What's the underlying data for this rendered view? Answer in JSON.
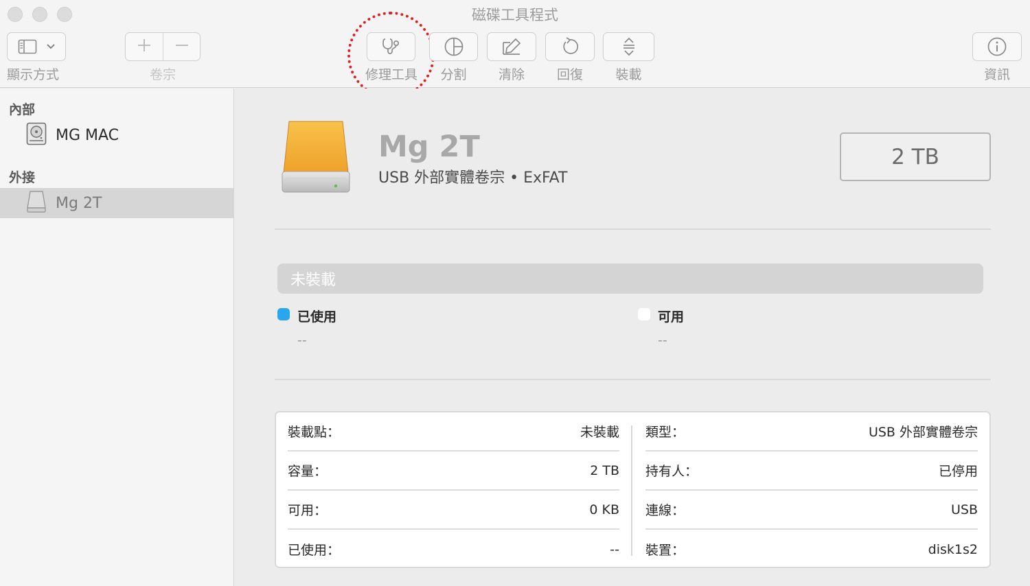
{
  "window": {
    "title": "磁碟工具程式"
  },
  "toolbar": {
    "view_label": "顯示方式",
    "volume_label": "卷宗",
    "repair_label": "修理工具",
    "partition_label": "分割",
    "erase_label": "清除",
    "restore_label": "回復",
    "mount_label": "裝載",
    "info_label": "資訊",
    "highlight_color": "#e02020"
  },
  "sidebar": {
    "internal_header": "內部",
    "internal_items": [
      {
        "label": "MG MAC",
        "icon": "internal-disk-icon"
      }
    ],
    "external_header": "外接",
    "external_items": [
      {
        "label": "Mg 2T",
        "icon": "external-disk-icon",
        "selected": true
      }
    ]
  },
  "volume": {
    "name": "Mg 2T",
    "subtitle": "USB 外部實體卷宗 • ExFAT",
    "capacity": "2 TB",
    "icon": "orange-external-drive-icon"
  },
  "usage": {
    "bar_label": "未裝載",
    "used_label": "已使用",
    "used_value": "--",
    "used_color": "#2aa6ef",
    "free_label": "可用",
    "free_value": "--",
    "free_color": "#ffffff"
  },
  "info": {
    "left": [
      {
        "key": "裝載點：",
        "value": "未裝載"
      },
      {
        "key": "容量：",
        "value": "2 TB"
      },
      {
        "key": "可用：",
        "value": "0 KB"
      },
      {
        "key": "已使用：",
        "value": "--"
      }
    ],
    "right": [
      {
        "key": "類型：",
        "value": "USB 外部實體卷宗"
      },
      {
        "key": "持有人：",
        "value": "已停用"
      },
      {
        "key": "連線：",
        "value": "USB"
      },
      {
        "key": "裝置：",
        "value": "disk1s2"
      }
    ]
  }
}
